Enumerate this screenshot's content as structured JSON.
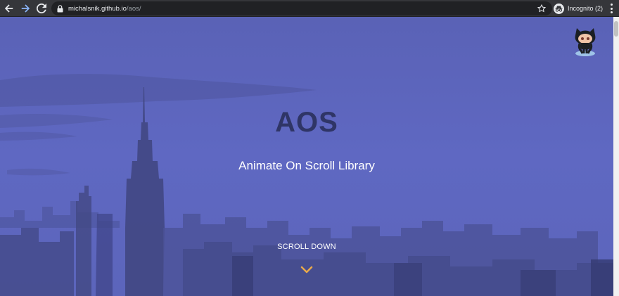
{
  "browser": {
    "url_host": "michalsnik.github.io",
    "url_path": "/aos/",
    "incognito_label": "Incognito (2)"
  },
  "icons": {
    "back": "back-arrow-icon",
    "forward": "forward-arrow-icon",
    "reload": "reload-icon",
    "lock": "lock-icon",
    "star": "star-icon",
    "incognito": "incognito-icon",
    "menu": "kebab-menu-icon",
    "github": "octocat-icon",
    "scroll": "chevron-down-icon"
  },
  "hero": {
    "title": "AOS",
    "subtitle": "Animate On Scroll Library",
    "scroll_label": "SCROLL DOWN"
  },
  "colors": {
    "overlay": "#5d67c0",
    "title": "#2f3566",
    "chevron": "#e8a94a"
  }
}
